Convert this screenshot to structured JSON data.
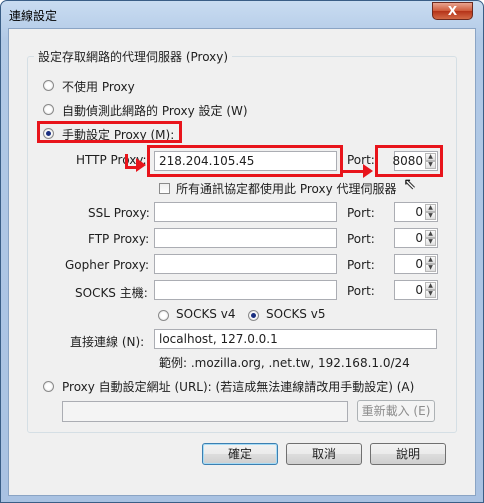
{
  "window": {
    "title": "連線設定",
    "close_glyph": "X"
  },
  "group_title": "設定存取網路的代理伺服器 (Proxy)",
  "options": {
    "no_proxy": "不使用 Proxy",
    "auto_detect": "自動偵測此網路的 Proxy 設定 (W)",
    "manual": "手動設定 Proxy (M):",
    "auto_url": "Proxy 自動設定網址 (URL): (若這成無法連線請改用手動設定) (A)"
  },
  "http": {
    "label": "HTTP Proxy:",
    "value": "218.204.105.45",
    "port_label": "Port:",
    "port": "8080"
  },
  "same_proxy_label": "所有通訊協定都使用此 Proxy 代理伺服器",
  "ssl": {
    "label": "SSL Proxy:",
    "value": "",
    "port_label": "Port:",
    "port": "0"
  },
  "ftp": {
    "label": "FTP Proxy:",
    "value": "",
    "port_label": "Port:",
    "port": "0"
  },
  "gopher": {
    "label": "Gopher Proxy:",
    "value": "",
    "port_label": "Port:",
    "port": "0"
  },
  "socks": {
    "label": "SOCKS 主機:",
    "value": "",
    "port_label": "Port:",
    "port": "0"
  },
  "socks_v4": "SOCKS v4",
  "socks_v5": "SOCKS v5",
  "no_proxy_for": {
    "label": "直接連線 (N):",
    "value": "localhost, 127.0.0.1",
    "example": "範例: .mozilla.org, .net.tw, 192.168.1.0/24"
  },
  "auto_url_value": "",
  "reload_button": "重新載入 (E)",
  "buttons": {
    "ok": "確定",
    "cancel": "取消",
    "help": "說明"
  },
  "colors": {
    "annotation": "#e8141b",
    "radio_selected": "#1a2f80"
  }
}
